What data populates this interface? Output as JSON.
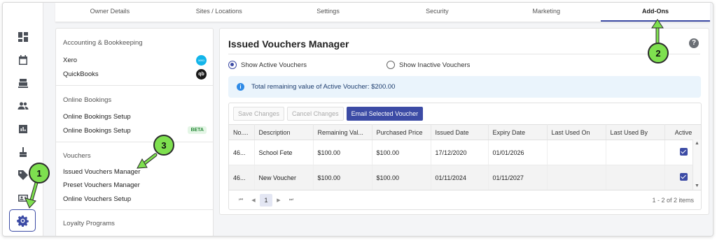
{
  "tabs": [
    {
      "label": "Owner Details"
    },
    {
      "label": "Sites / Locations"
    },
    {
      "label": "Settings"
    },
    {
      "label": "Security"
    },
    {
      "label": "Marketing"
    },
    {
      "label": "Add-Ons"
    }
  ],
  "active_tab": "Add-Ons",
  "rail": {
    "icons": [
      "dashboard-icon",
      "calendar-icon",
      "register-icon",
      "people-icon",
      "report-icon",
      "broom-icon",
      "tag-icon",
      "id-card-icon",
      "gear-icon"
    ]
  },
  "panel": {
    "accounting_title": "Accounting & Bookkeeping",
    "xero": "Xero",
    "xero_logo_text": "xero",
    "quickbooks": "QuickBooks",
    "qb_logo_text": "qb",
    "online_bookings_title": "Online Bookings",
    "ob_setup_1": "Online Bookings Setup",
    "ob_setup_2": "Online Bookings Setup",
    "beta": "BETA",
    "vouchers_title": "Vouchers",
    "issued": "Issued Vouchers Manager",
    "preset": "Preset Vouchers Manager",
    "online_vouchers": "Online Vouchers Setup",
    "loyalty_title": "Loyalty Programs"
  },
  "main": {
    "title": "Issued Vouchers Manager",
    "help": "?",
    "radio_active": "Show Active Vouchers",
    "radio_inactive": "Show Inactive Vouchers",
    "info_icon": "i",
    "info_text": "Total remaining value of Active Voucher: $200.00",
    "btn_save": "Save Changes",
    "btn_cancel": "Cancel Changes",
    "btn_email": "Email Selected Voucher",
    "columns": [
      "No....",
      "Description",
      "Remaining Val...",
      "Purchased Price",
      "Issued Date",
      "Expiry Date",
      "Last Used On",
      "Last Used By",
      "Active"
    ],
    "rows": [
      {
        "no": "46...",
        "desc": "School Fete",
        "remaining": "$100.00",
        "price": "$100.00",
        "issued": "17/12/2020",
        "expiry": "01/01/2026",
        "last_on": "",
        "last_by": "",
        "active": true
      },
      {
        "no": "46...",
        "desc": "New Voucher",
        "remaining": "$100.00",
        "price": "$100.00",
        "issued": "01/11/2024",
        "expiry": "01/11/2027",
        "last_on": "",
        "last_by": "",
        "active": true
      }
    ],
    "page": "1",
    "count": "1 - 2 of 2 items"
  },
  "callouts": [
    "1",
    "2",
    "3"
  ],
  "colors": {
    "accent": "#3c4ba5",
    "callout": "#7ee04f"
  }
}
